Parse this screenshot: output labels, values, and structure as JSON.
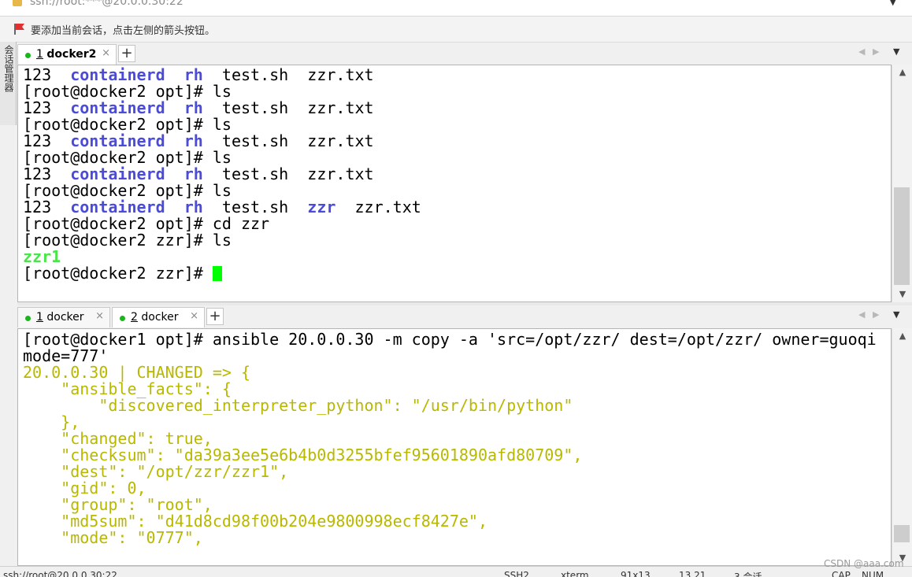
{
  "address": {
    "text": "ssh://root:***@20.0.0.30:22"
  },
  "hint": {
    "text": "要添加当前会话，点击左侧的箭头按钮。"
  },
  "sidebar": {
    "label": "会话管理器"
  },
  "pane1": {
    "tabs": [
      {
        "number": "1",
        "name": "docker2",
        "close": "×",
        "status_color": "#18b818"
      }
    ],
    "new_tab": "+",
    "lines": [
      [
        {
          "t": "123  "
        },
        {
          "t": "containerd",
          "c": "blue"
        },
        {
          "t": "  "
        },
        {
          "t": "rh",
          "c": "blue"
        },
        {
          "t": "  test.sh  zzr.txt"
        }
      ],
      [
        {
          "t": "[root@docker2 opt]# ls"
        }
      ],
      [
        {
          "t": "123  "
        },
        {
          "t": "containerd",
          "c": "blue"
        },
        {
          "t": "  "
        },
        {
          "t": "rh",
          "c": "blue"
        },
        {
          "t": "  test.sh  zzr.txt"
        }
      ],
      [
        {
          "t": "[root@docker2 opt]# ls"
        }
      ],
      [
        {
          "t": "123  "
        },
        {
          "t": "containerd",
          "c": "blue"
        },
        {
          "t": "  "
        },
        {
          "t": "rh",
          "c": "blue"
        },
        {
          "t": "  test.sh  zzr.txt"
        }
      ],
      [
        {
          "t": "[root@docker2 opt]# ls"
        }
      ],
      [
        {
          "t": "123  "
        },
        {
          "t": "containerd",
          "c": "blue"
        },
        {
          "t": "  "
        },
        {
          "t": "rh",
          "c": "blue"
        },
        {
          "t": "  test.sh  zzr.txt"
        }
      ],
      [
        {
          "t": "[root@docker2 opt]# ls"
        }
      ],
      [
        {
          "t": "123  "
        },
        {
          "t": "containerd",
          "c": "blue"
        },
        {
          "t": "  "
        },
        {
          "t": "rh",
          "c": "blue"
        },
        {
          "t": "  test.sh  "
        },
        {
          "t": "zzr",
          "c": "blue"
        },
        {
          "t": "  zzr.txt"
        }
      ],
      [
        {
          "t": "[root@docker2 opt]# cd zzr"
        }
      ],
      [
        {
          "t": "[root@docker2 zzr]# ls"
        }
      ],
      [
        {
          "t": "zzr1",
          "c": "green"
        }
      ],
      [
        {
          "t": "[root@docker2 zzr]# "
        },
        {
          "cursor": true
        }
      ]
    ]
  },
  "pane2": {
    "tabs": [
      {
        "number": "1",
        "name": "docker",
        "close": "×",
        "status_color": "#18b818"
      },
      {
        "number": "2",
        "name": "docker",
        "close": "×",
        "status_color": "#18b818"
      }
    ],
    "new_tab": "+",
    "lines": [
      [
        {
          "t": "[root@docker1 opt]# ansible 20.0.0.30 -m copy -a 'src=/opt/zzr/ dest=/opt/zzr/ owner=guoqi"
        }
      ],
      [
        {
          "t": "mode=777'"
        }
      ],
      [
        {
          "t": "20.0.0.30 | CHANGED => {",
          "c": "yel"
        }
      ],
      [
        {
          "t": "    \"ansible_facts\": {",
          "c": "yel"
        }
      ],
      [
        {
          "t": "        \"discovered_interpreter_python\": \"/usr/bin/python\"",
          "c": "yel"
        }
      ],
      [
        {
          "t": "    },",
          "c": "yel"
        }
      ],
      [
        {
          "t": "    \"changed\": true,",
          "c": "yel"
        }
      ],
      [
        {
          "t": "    \"checksum\": \"da39a3ee5e6b4b0d3255bfef95601890afd80709\",",
          "c": "yel"
        }
      ],
      [
        {
          "t": "    \"dest\": \"/opt/zzr/zzr1\",",
          "c": "yel"
        }
      ],
      [
        {
          "t": "    \"gid\": 0,",
          "c": "yel"
        }
      ],
      [
        {
          "t": "    \"group\": \"root\",",
          "c": "yel"
        }
      ],
      [
        {
          "t": "    \"md5sum\": \"d41d8cd98f00b204e9800998ecf8427e\",",
          "c": "yel"
        }
      ],
      [
        {
          "t": "    \"mode\": \"0777\",",
          "c": "yel"
        }
      ]
    ]
  },
  "statusbar": {
    "address": "ssh://root@20.0.0.30:22",
    "protocol": "SSH2",
    "terminal": "xterm",
    "size": "91x13",
    "position": "13,21",
    "sessions": "3 会话",
    "cap": "CAP",
    "num": "NUM"
  },
  "watermark": "CSDN @aaa.com",
  "colors": {
    "dir_blue": "#4b4bdb",
    "exec_green": "#48e648",
    "output_yellow": "#b8b800",
    "cursor": "#00ff00"
  }
}
